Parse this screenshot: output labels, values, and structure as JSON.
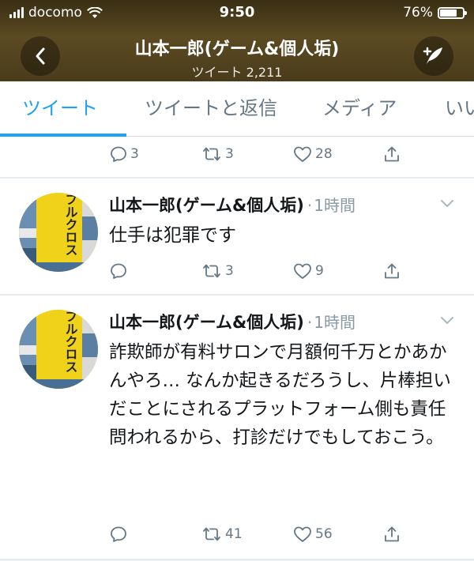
{
  "status_bar": {
    "carrier": "docomo",
    "time": "9:50",
    "battery_percent": "76%",
    "battery_level": 0.76
  },
  "header": {
    "title": "山本一郎(ゲーム&個人垢)",
    "subtitle": "ツイート 2,211"
  },
  "tabs": [
    {
      "label": "ツイート",
      "active": true
    },
    {
      "label": "ツイートと返信",
      "active": false
    },
    {
      "label": "メディア",
      "active": false
    },
    {
      "label": "いい",
      "active": false
    }
  ],
  "tweets": [
    {
      "actions": {
        "replies": "3",
        "retweets": "3",
        "likes": "28"
      }
    },
    {
      "author": "山本一郎(ゲーム&個人垢)",
      "separator": "·",
      "time": "1時間",
      "text": "仕手は犯罪です",
      "avatar_text": "テーブルクロス",
      "actions": {
        "replies": "",
        "retweets": "3",
        "likes": "9"
      }
    },
    {
      "author": "山本一郎(ゲーム&個人垢)",
      "separator": "·",
      "time": "1時間",
      "text": "詐欺師が有料サロンで月額何千万とかあかんやろ… なんか起きるだろうし、片棒担いだことにされるプラットフォーム側も責任問われるから、打診だけでもしておこう。",
      "avatar_text": "テーブルクロス",
      "actions": {
        "replies": "",
        "retweets": "41",
        "likes": "56"
      }
    }
  ],
  "colors": {
    "accent": "#1da1f2",
    "icon_gray": "#657786",
    "avatar_bg": "#f1d21b"
  }
}
